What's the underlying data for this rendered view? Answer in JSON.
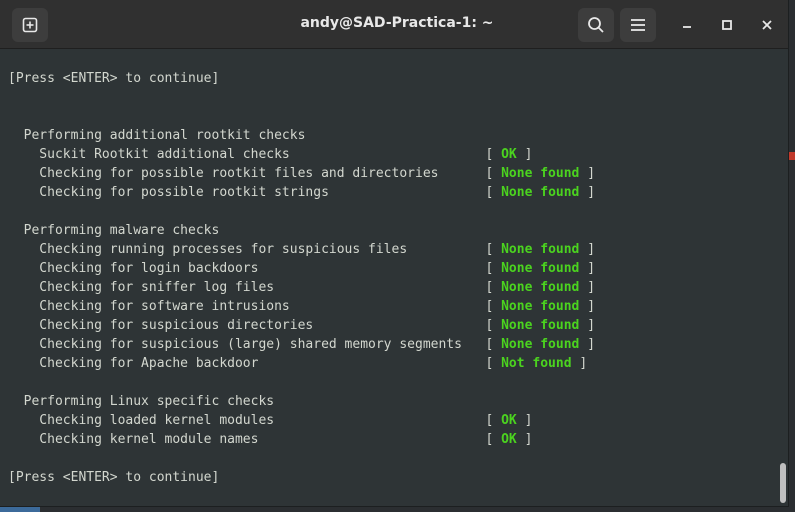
{
  "window": {
    "title": "andy@SAD-Practica-1: ~"
  },
  "titlebar": {
    "buttons": {
      "new_tab": "new-tab-icon",
      "search": "search-icon",
      "menu": "hamburger-menu-icon",
      "minimize": "minimize-icon",
      "maximize": "maximize-icon",
      "close": "close-icon"
    }
  },
  "colors": {
    "ok_green": "#4bd31f",
    "text": "#d3d7cf",
    "background": "#2e3436"
  },
  "terminal": {
    "lines": [
      {
        "text": "[Press <ENTER> to continue]"
      },
      {
        "text": ""
      },
      {
        "text": ""
      },
      {
        "text": "  Performing additional rootkit checks"
      },
      {
        "text": "    Suckit Rootkit additional checks",
        "status": "OK"
      },
      {
        "text": "    Checking for possible rootkit files and directories",
        "status": "None found"
      },
      {
        "text": "    Checking for possible rootkit strings",
        "status": "None found"
      },
      {
        "text": ""
      },
      {
        "text": "  Performing malware checks"
      },
      {
        "text": "    Checking running processes for suspicious files",
        "status": "None found"
      },
      {
        "text": "    Checking for login backdoors",
        "status": "None found"
      },
      {
        "text": "    Checking for sniffer log files",
        "status": "None found"
      },
      {
        "text": "    Checking for software intrusions",
        "status": "None found"
      },
      {
        "text": "    Checking for suspicious directories",
        "status": "None found"
      },
      {
        "text": "    Checking for suspicious (large) shared memory segments",
        "status": "None found"
      },
      {
        "text": "    Checking for Apache backdoor",
        "status": "Not found"
      },
      {
        "text": ""
      },
      {
        "text": "  Performing Linux specific checks"
      },
      {
        "text": "    Checking loaded kernel modules",
        "status": "OK"
      },
      {
        "text": "    Checking kernel module names",
        "status": "OK"
      },
      {
        "text": ""
      },
      {
        "text": "[Press <ENTER> to continue]"
      }
    ]
  }
}
